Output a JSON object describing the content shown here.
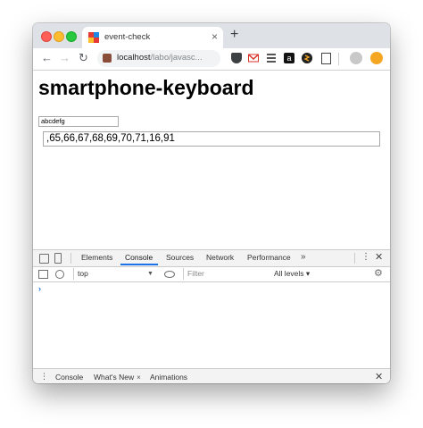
{
  "browser": {
    "tab": {
      "title": "event-check",
      "close": "×"
    },
    "new_tab": "+",
    "nav": {
      "back": "←",
      "forward": "→",
      "reload": "↻"
    },
    "url": {
      "host": "localhost",
      "path": "/labo/javasc..."
    },
    "extensions": [
      "pocket-icon",
      "gmail-icon",
      "stack-icon",
      "amazon-icon",
      "s-icon",
      "calculator-icon"
    ],
    "amazon_letter": "a"
  },
  "page": {
    "heading": "smartphone-keyboard",
    "small_input_value": "abcdefg",
    "big_input_value": ",65,66,67,68,69,70,71,16,91"
  },
  "devtools": {
    "tabs": [
      "Elements",
      "Console",
      "Sources",
      "Network",
      "Performance"
    ],
    "active_tab": "Console",
    "more": "»",
    "kebab": "⋮",
    "close": "✕",
    "context": "top",
    "context_arrow": "▼",
    "filter_placeholder": "Filter",
    "levels": "All levels ▾",
    "gear": "⚙",
    "prompt": "›",
    "drawer": {
      "kebab": "⋮",
      "tabs": [
        "Console",
        "What's New",
        "Animations"
      ],
      "active": "What's New",
      "tab_close": "×",
      "close": "✕"
    }
  },
  "colors": {
    "accent": "#1a73e8",
    "tab_strip": "#dee1e6",
    "devtools_bar": "#f3f3f3"
  }
}
